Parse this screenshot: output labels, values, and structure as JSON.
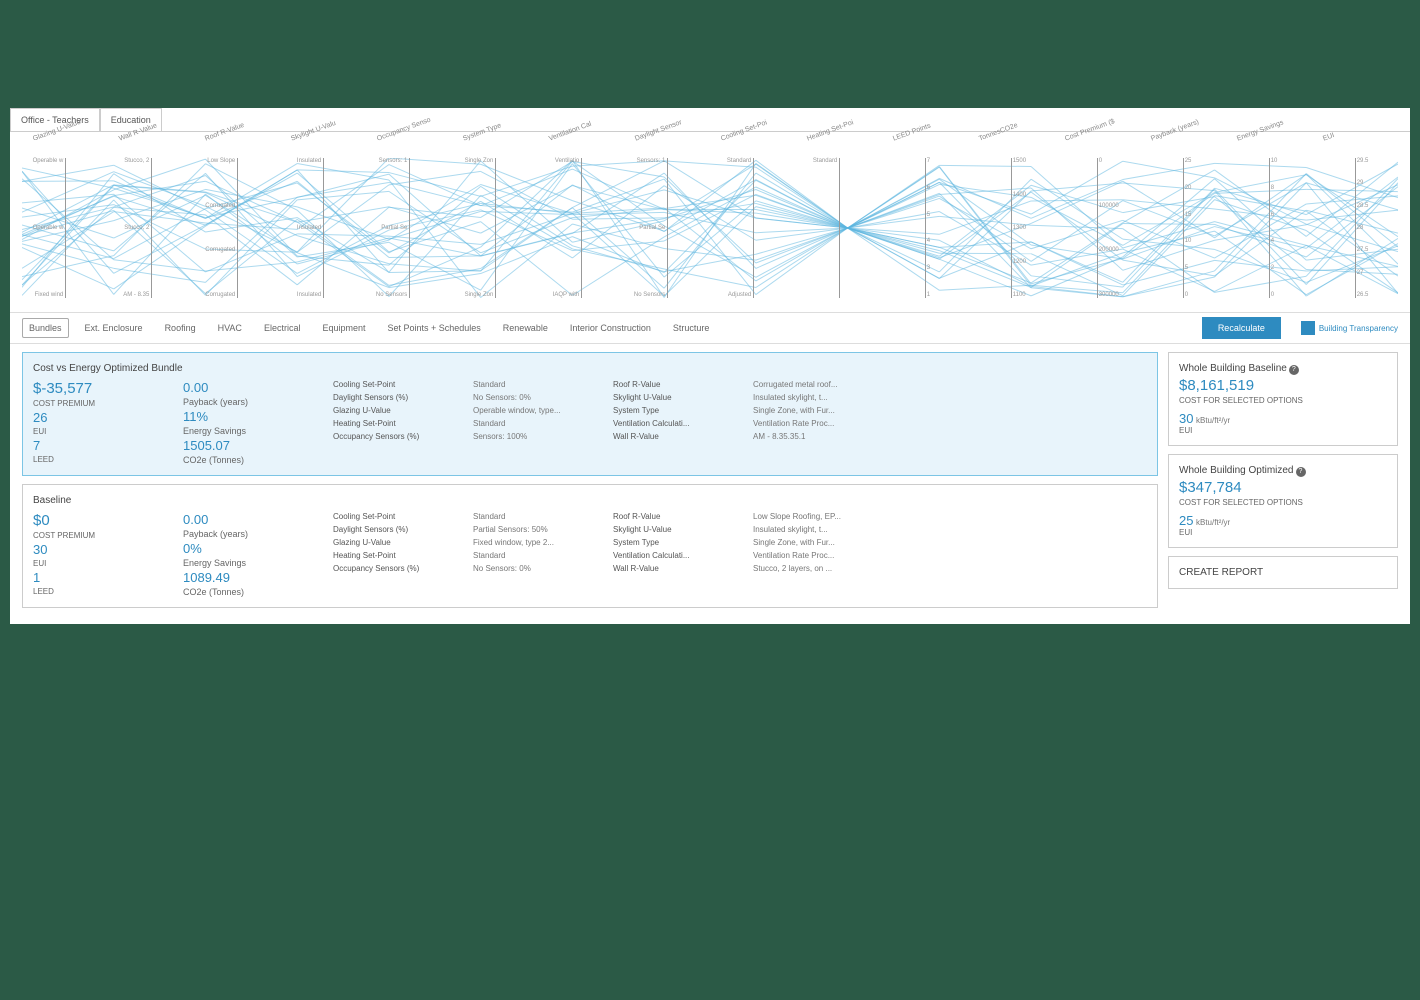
{
  "topTabs": {
    "t0": "Office - Teachers",
    "t1": "Education"
  },
  "axes": [
    {
      "title": "Glazing U-Value",
      "ticks": [
        "Operable w",
        "Operable w",
        "Fixed wind"
      ]
    },
    {
      "title": "Wall R-Value",
      "ticks": [
        "Stucco, 2",
        "Stucco, 2",
        "AM - 8.35"
      ]
    },
    {
      "title": "Roof R-Value",
      "ticks": [
        "Low Slope",
        "Corrugated",
        "Corrugated",
        "Corrugated"
      ]
    },
    {
      "title": "Skylight U-Valu",
      "ticks": [
        "Insulated",
        "Insulated",
        "Insulated"
      ]
    },
    {
      "title": "Occupancy Senso",
      "ticks": [
        "Sensors: 1",
        "Partial Se",
        "No Sensors"
      ]
    },
    {
      "title": "System Type",
      "ticks": [
        "Single Zon",
        "Single Zon"
      ]
    },
    {
      "title": "Ventilation Cal",
      "ticks": [
        "Ventilatio",
        "IAQP with"
      ]
    },
    {
      "title": "Daylight Sensor",
      "ticks": [
        "Sensors: 1",
        "Partial Se",
        "No Sensors"
      ]
    },
    {
      "title": "Cooling Set-Poi",
      "ticks": [
        "Standard",
        "Adjusted"
      ]
    },
    {
      "title": "Heating Set-Poi",
      "ticks": [
        "Standard"
      ]
    },
    {
      "title": "LEED Points",
      "ticks": [
        "7",
        "6",
        "5",
        "4",
        "3",
        "1"
      ]
    },
    {
      "title": "TonnesCO2e",
      "ticks": [
        "1500",
        "1400",
        "1300",
        "1200",
        "1100"
      ]
    },
    {
      "title": "Cost Premium ($",
      "ticks": [
        "0",
        "100000",
        "200000",
        "300000"
      ]
    },
    {
      "title": "Payback (years)",
      "ticks": [
        "25",
        "20",
        "15",
        "10",
        "5",
        "0"
      ]
    },
    {
      "title": "Energy Savings",
      "ticks": [
        "10",
        "8",
        "6",
        "4",
        "2",
        "0"
      ]
    },
    {
      "title": "EUI",
      "ticks": [
        "29.5",
        "29",
        "28.5",
        "28",
        "27.5",
        "27",
        "26.5"
      ]
    }
  ],
  "catTabs": [
    "Bundles",
    "Ext. Enclosure",
    "Roofing",
    "HVAC",
    "Electrical",
    "Equipment",
    "Set Points + Schedules",
    "Renewable",
    "Interior Construction",
    "Structure"
  ],
  "recalc": "Recalculate",
  "btLabel": "Building\nTransparency",
  "bundles": [
    {
      "title": "Cost vs Energy Optimized Bundle",
      "highlight": true,
      "metrics": {
        "cost": "$-35,577",
        "costLbl": "COST PREMIUM",
        "eui": "26",
        "euiLbl": "EUI",
        "leed": "7",
        "leedLbl": "LEED",
        "payback": "0.00",
        "paybackLbl": "Payback (years)",
        "savings": "11%",
        "savingsLbl": "Energy Savings",
        "co2": "1505.07",
        "co2Lbl": "CO2e (Tonnes)"
      },
      "params": [
        {
          "l": "Cooling Set-Point",
          "v": "Standard"
        },
        {
          "l": "Daylight Sensors (%)",
          "v": "No Sensors: 0%"
        },
        {
          "l": "Glazing U-Value",
          "v": "Operable window, type..."
        },
        {
          "l": "Heating Set-Point",
          "v": "Standard"
        },
        {
          "l": "Occupancy Sensors (%)",
          "v": "Sensors: 100%"
        },
        {
          "l": "Roof R-Value",
          "v": "Corrugated metal roof..."
        },
        {
          "l": "Skylight U-Value",
          "v": "Insulated skylight, t..."
        },
        {
          "l": "System Type",
          "v": "Single Zone, with Fur..."
        },
        {
          "l": "Ventilation Calculati...",
          "v": "Ventilation Rate Proc..."
        },
        {
          "l": "Wall R-Value",
          "v": "AM - 8.35.35.1"
        }
      ]
    },
    {
      "title": "Baseline",
      "highlight": false,
      "metrics": {
        "cost": "$0",
        "costLbl": "COST PREMIUM",
        "eui": "30",
        "euiLbl": "EUI",
        "leed": "1",
        "leedLbl": "LEED",
        "payback": "0.00",
        "paybackLbl": "Payback (years)",
        "savings": "0%",
        "savingsLbl": "Energy Savings",
        "co2": "1089.49",
        "co2Lbl": "CO2e (Tonnes)"
      },
      "params": [
        {
          "l": "Cooling Set-Point",
          "v": "Standard"
        },
        {
          "l": "Daylight Sensors (%)",
          "v": "Partial Sensors: 50%"
        },
        {
          "l": "Glazing U-Value",
          "v": "Fixed window, type 2..."
        },
        {
          "l": "Heating Set-Point",
          "v": "Standard"
        },
        {
          "l": "Occupancy Sensors (%)",
          "v": "No Sensors: 0%"
        },
        {
          "l": "Roof R-Value",
          "v": "Low Slope Roofing, EP..."
        },
        {
          "l": "Skylight U-Value",
          "v": "Insulated skylight, t..."
        },
        {
          "l": "System Type",
          "v": "Single Zone, with Fur..."
        },
        {
          "l": "Ventilation Calculati...",
          "v": "Ventilation Rate Proc..."
        },
        {
          "l": "Wall R-Value",
          "v": "Stucco, 2 layers, on ..."
        }
      ]
    }
  ],
  "side": {
    "baseline": {
      "title": "Whole Building Baseline",
      "cost": "$8,161,519",
      "sub": "COST FOR SELECTED OPTIONS",
      "eui": "30",
      "unit": "kBtu/ft²/yr",
      "euiLbl": "EUI"
    },
    "optimized": {
      "title": "Whole Building Optimized",
      "cost": "$347,784",
      "sub": "COST FOR SELECTED OPTIONS",
      "eui": "25",
      "unit": "kBtu/ft²/yr",
      "euiLbl": "EUI"
    },
    "report": "CREATE REPORT"
  },
  "chart_data": {
    "type": "parallel-coordinates",
    "note": "approximate structure of many polylines across 16 categorical/numeric axes; exact per-line values not individually legible",
    "axes_count": 16,
    "approx_line_count": 30
  }
}
